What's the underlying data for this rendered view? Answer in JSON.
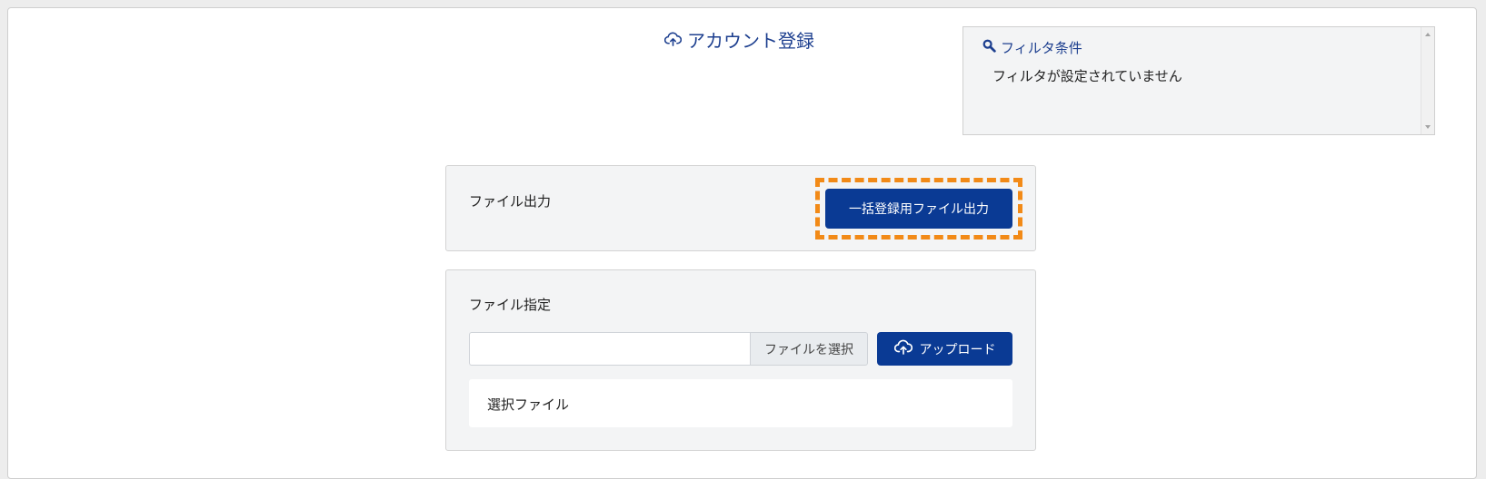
{
  "header": {
    "title": "アカウント登録",
    "title_icon": "cloud-upload-icon"
  },
  "filter": {
    "title": "フィルタ条件",
    "icon": "search-icon",
    "text": "フィルタが設定されていません"
  },
  "export": {
    "label": "ファイル出力",
    "button_label": "一括登録用ファイル出力",
    "highlight_color": "#f28a17"
  },
  "upload": {
    "label": "ファイル指定",
    "file_input_value": "",
    "browse_label": "ファイルを選択",
    "upload_button_label": "アップロード",
    "upload_icon": "cloud-upload-icon",
    "selected_label": "選択ファイル"
  },
  "colors": {
    "primary": "#0a3a94",
    "title": "#1d3f8f",
    "panel_bg": "#f3f4f5"
  }
}
